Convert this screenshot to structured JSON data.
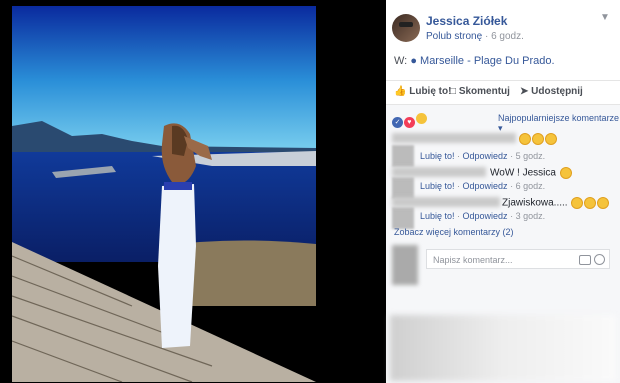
{
  "post": {
    "author": "Jessica Ziółek",
    "like_page": "Polub stronę",
    "separator": "·",
    "time": "6 godz.",
    "location_prefix": "W:",
    "location": "Marseille - Plage Du Prado."
  },
  "actions": {
    "like": "Lubię to!",
    "comment": "Skomentuj",
    "share": "Udostępnij"
  },
  "comments": {
    "sort_label": "Najpopularniejsze komentarze",
    "items": [
      {
        "text": "",
        "like": "Lubię to!",
        "reply": "Odpowiedz",
        "time": "5 godz."
      },
      {
        "text": "WoW ! Jessica",
        "like": "Lubię to!",
        "reply": "Odpowiedz",
        "time": "6 godz."
      },
      {
        "text": "Zjawiskowa.....",
        "like": "Lubię to!",
        "reply": "Odpowiedz",
        "time": "3 godz."
      }
    ],
    "see_more": "Zobacz więcej komentarzy (2)",
    "input_placeholder": "Napisz komentarz..."
  },
  "colors": {
    "link": "#365899",
    "muted": "#90949c",
    "like_blue": "#4267b2",
    "heart": "#f33e58"
  }
}
